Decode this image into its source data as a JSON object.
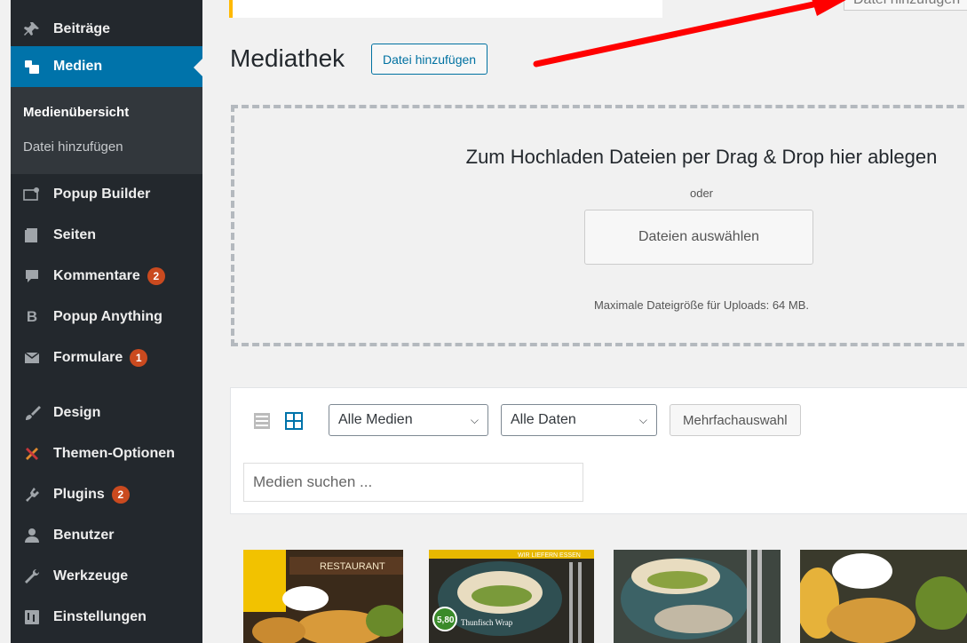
{
  "sidebar": {
    "items": [
      {
        "label": "Beiträge",
        "icon": "pin-icon"
      },
      {
        "label": "Medien",
        "icon": "media-icon"
      },
      {
        "label": "Popup Builder",
        "icon": "popup-builder-icon"
      },
      {
        "label": "Seiten",
        "icon": "pages-icon"
      },
      {
        "label": "Kommentare",
        "icon": "comment-icon",
        "badge": "2"
      },
      {
        "label": "Popup Anything",
        "icon": "b-icon"
      },
      {
        "label": "Formulare",
        "icon": "mail-icon",
        "badge": "1"
      },
      {
        "label": "Design",
        "icon": "brush-icon"
      },
      {
        "label": "Themen-Optionen",
        "icon": "tools-cross-icon"
      },
      {
        "label": "Plugins",
        "icon": "plugin-icon",
        "badge": "2"
      },
      {
        "label": "Benutzer",
        "icon": "user-icon"
      },
      {
        "label": "Werkzeuge",
        "icon": "wrench-icon"
      },
      {
        "label": "Einstellungen",
        "icon": "settings-icon"
      }
    ],
    "submenu": {
      "overview": "Medienübersicht",
      "add": "Datei hinzufügen"
    }
  },
  "header": {
    "top_button": "Datei hinzufügen",
    "title": "Mediathek",
    "add_button": "Datei hinzufügen"
  },
  "upload": {
    "title": "Zum Hochladen Dateien per Drag & Drop hier ablegen",
    "or": "oder",
    "select_button": "Dateien auswählen",
    "max_size": "Maximale Dateigröße für Uploads: 64 MB."
  },
  "toolbar": {
    "filter_media": "Alle Medien",
    "filter_dates": "Alle Daten",
    "bulk_select": "Mehrfachauswahl",
    "search_placeholder": "Medien suchen ..."
  },
  "thumbnails": {
    "t1_label": "RESTAURANT",
    "t2_price": "5,80",
    "t2_caption": "Thunfisch Wrap",
    "t2_banner": "WIR LIEFERN ESSEN"
  },
  "colors": {
    "sidebar_bg": "#23282d",
    "active_bg": "#0073aa",
    "badge": "#ca4a1f",
    "arrow": "#ff0000"
  }
}
